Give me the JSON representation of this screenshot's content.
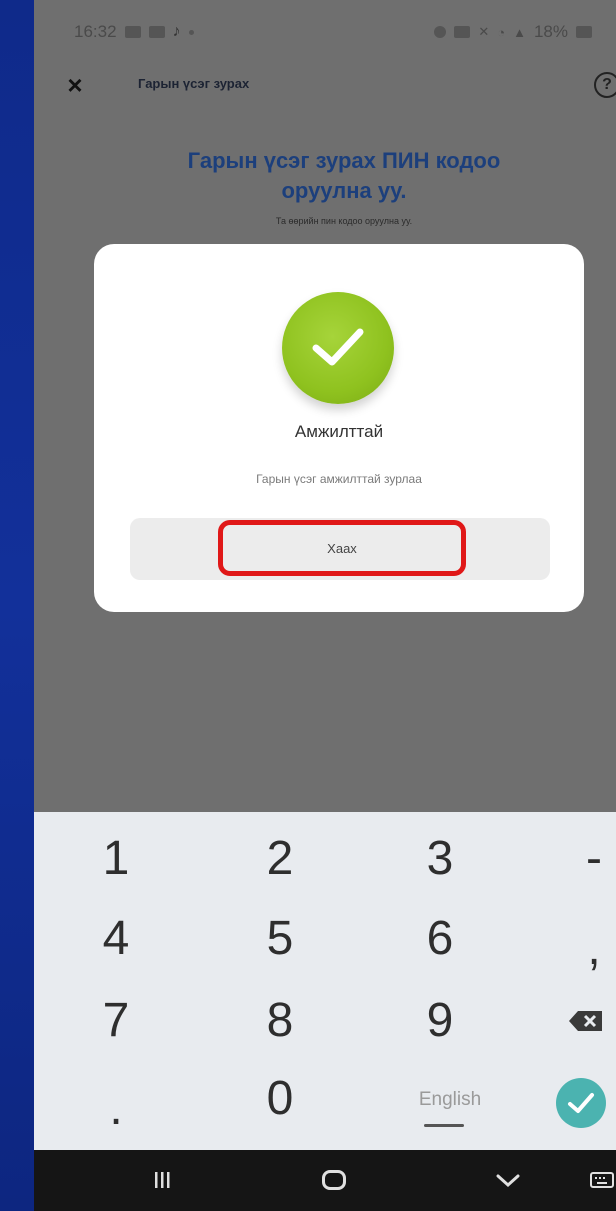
{
  "status_bar": {
    "time": "16:32",
    "battery": "18%"
  },
  "app_bar": {
    "title": "Гарын үсэг зурах",
    "close_icon": "×",
    "help_icon": "?"
  },
  "content": {
    "heading_line1": "Гарын үсэг зурах ПИН кодоо",
    "heading_line2": "оруулна уу.",
    "subheading": "Та өөрийн пин кодоо оруулна уу."
  },
  "dialog": {
    "title": "Амжилттай",
    "message": "Гарын үсэг амжилттай зурлаа",
    "close_label": "Хаах"
  },
  "keyboard": {
    "keys": [
      "1",
      "2",
      "3",
      "-",
      "4",
      "5",
      "6",
      ",",
      "7",
      "8",
      "9",
      ".",
      "0"
    ],
    "language": "English"
  },
  "colors": {
    "success": "#8fc21f",
    "highlight": "#e01818",
    "heading": "#1c3f7c",
    "done": "#4bb3b0"
  }
}
